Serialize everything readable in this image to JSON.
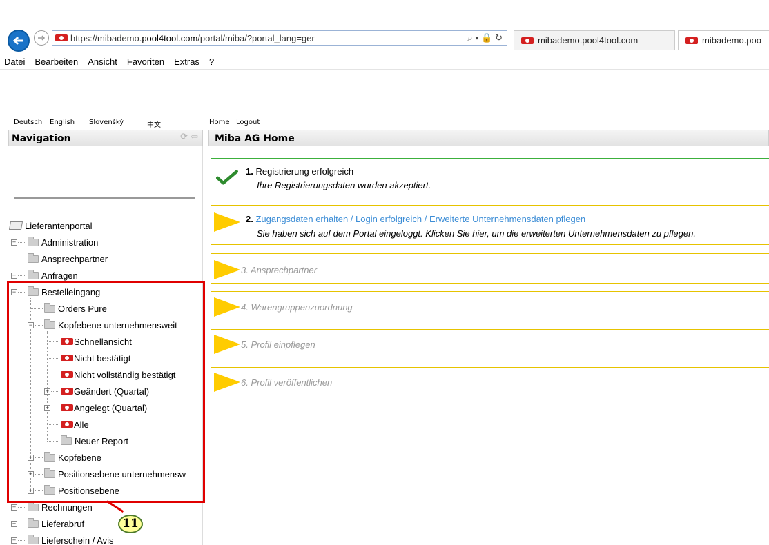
{
  "browser": {
    "url_prefix": "https://mibademo.",
    "url_domain": "pool4tool.com",
    "url_path": "/portal/miba/?portal_lang=ger",
    "url_tools": "⌕ ▾ 🔒 ↻",
    "tabs": [
      {
        "label": "mibademo.pool4tool.com"
      },
      {
        "label": "mibademo.poo"
      }
    ],
    "menu": [
      "Datei",
      "Bearbeiten",
      "Ansicht",
      "Favoriten",
      "Extras",
      "?"
    ]
  },
  "langbar": {
    "items": [
      "Deutsch",
      "English",
      "Slovenšký",
      "中文",
      "Home",
      "Logout"
    ]
  },
  "navigation": {
    "title": "Navigation",
    "tools": "⟳ ⇦",
    "tree": {
      "root": "Lieferantenportal",
      "administration": "Administration",
      "ansprechpartner": "Ansprechpartner",
      "anfragen": "Anfragen",
      "bestelleingang": "Bestelleingang",
      "orders_pure": "Orders Pure",
      "kopfebene_uw": "Kopfebene unternehmensweit",
      "schnellansicht": "Schnellansicht",
      "nicht_bestaetigt": "Nicht bestätigt",
      "nicht_vollstaendig": "Nicht vollständig bestätigt",
      "geaendert": "Geändert (Quartal)",
      "angelegt": "Angelegt (Quartal)",
      "alle": "Alle",
      "neuer_report": "Neuer Report",
      "kopfebene": "Kopfebene",
      "positionsebene_uw": "Positionsebene unternehmensw",
      "positionsebene": "Positionsebene",
      "rechnungen": "Rechnungen",
      "lieferabruf": "Lieferabruf",
      "lieferschein": "Lieferschein / Avis"
    }
  },
  "annotation": {
    "badge": "11"
  },
  "main": {
    "title": "Miba AG Home",
    "steps": [
      {
        "num": "1.",
        "title": "Registrierung erfolgreich",
        "sub": "Ihre Registrierungsdaten wurden akzeptiert."
      },
      {
        "num": "2.",
        "title": "Zugangsdaten erhalten / Login erfolgreich / Erweiterte Unternehmensdaten pflegen",
        "sub": "Sie haben sich auf dem Portal eingeloggt. Klicken Sie hier, um die erweiterten Unternehmensdaten zu pflegen."
      },
      {
        "title": "3. Ansprechpartner"
      },
      {
        "title": "4. Warengruppenzuordnung"
      },
      {
        "title": "5. Profil einpflegen"
      },
      {
        "title": "6. Profil veröffentlichen"
      }
    ]
  },
  "colors": {
    "accent_blue": "#1a73c8",
    "arrow_yellow": "#ffcc00",
    "success_green": "#2e8b2e",
    "link_blue": "#3c8dd6",
    "highlight_red": "#e00000"
  }
}
